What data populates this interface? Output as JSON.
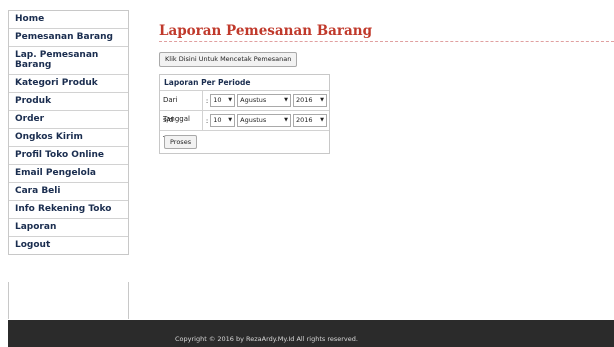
{
  "sidebar": {
    "items": [
      {
        "label": "Home"
      },
      {
        "label": "Pemesanan Barang"
      },
      {
        "label": "Lap. Pemesanan\nBarang"
      },
      {
        "label": "Kategori Produk"
      },
      {
        "label": "Produk"
      },
      {
        "label": "Order"
      },
      {
        "label": "Ongkos Kirim"
      },
      {
        "label": "Profil Toko Online"
      },
      {
        "label": "Email Pengelola"
      },
      {
        "label": "Cara Beli"
      },
      {
        "label": "Info Rekening Toko"
      },
      {
        "label": "Laporan"
      },
      {
        "label": "Logout"
      }
    ]
  },
  "main": {
    "title": "Laporan Pemesanan Barang",
    "print_button_label": "Klik Disini Untuk Mencetak Pemesanan",
    "period": {
      "title": "Laporan Per Periode",
      "separator": ":",
      "from": {
        "label": "Dari Tanggal",
        "day": "10",
        "month": "Agustus",
        "year": "2016"
      },
      "to": {
        "label": "s/d Tanggal",
        "day": "10",
        "month": "Agustus",
        "year": "2016"
      },
      "submit_label": "Proses"
    }
  },
  "footer": {
    "text": "Copyright © 2016 by RezaArdy.My.Id All rights reserved."
  },
  "colors": {
    "title": "#c0392b",
    "nav_text": "#1a2d4f",
    "footer_bg": "#2b2b2b"
  }
}
